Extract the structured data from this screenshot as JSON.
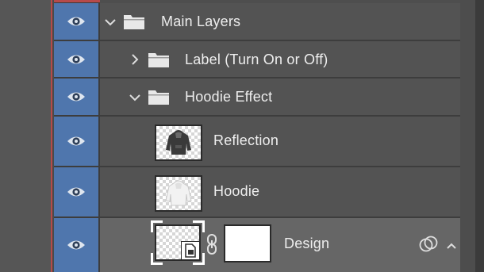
{
  "layers_panel": {
    "rows": [
      {
        "name": "Main Layers",
        "type": "group",
        "expanded": true,
        "level": 0,
        "visible": true
      },
      {
        "name": "Label (Turn On or Off)",
        "type": "group",
        "expanded": false,
        "level": 1,
        "visible": true
      },
      {
        "name": "Hoodie Effect",
        "type": "group",
        "expanded": true,
        "level": 1,
        "visible": true
      },
      {
        "name": "Reflection",
        "type": "layer",
        "level": 2,
        "visible": true
      },
      {
        "name": "Hoodie",
        "type": "layer",
        "level": 2,
        "visible": true
      },
      {
        "name": "Design",
        "type": "smart-object-layer",
        "level": 2,
        "visible": true,
        "selected": true,
        "has_mask": true,
        "linked": true
      }
    ]
  },
  "icons": {
    "eye": "eye-icon",
    "folder": "folder-icon",
    "caret_expanded": "chevron-down-icon",
    "caret_collapsed": "chevron-right-icon",
    "link": "link-chain-icon",
    "smart_object_badge": "smart-object-icon",
    "clip": "overlap-circles-icon",
    "expand_effects": "chevron-up-icon"
  },
  "colors": {
    "visibility_column": "#4f76ad",
    "row_background": "#535353",
    "selected_row": "#666666",
    "text": "#eeeeee"
  }
}
